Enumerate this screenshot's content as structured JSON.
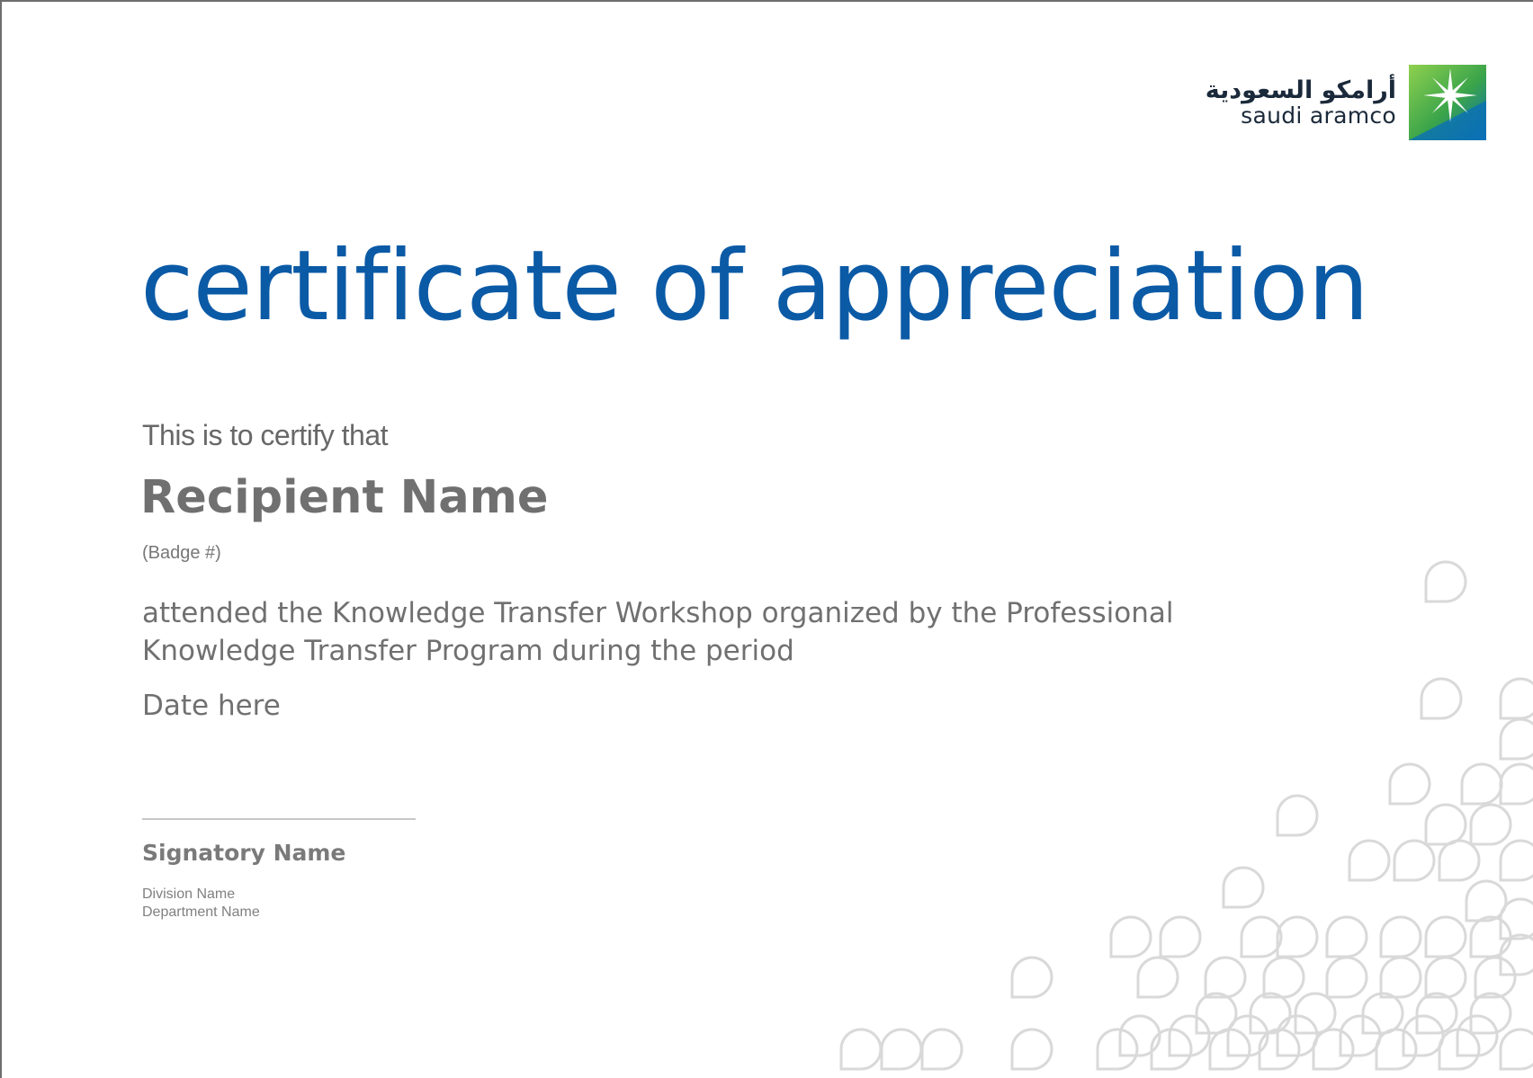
{
  "logo": {
    "arabic": "أرامكو السعودية",
    "latin": "saudi aramco"
  },
  "certificate": {
    "title": "certificate of appreciation",
    "certify_line": "This is to certify that",
    "recipient": "Recipient Name",
    "badge": "(Badge #)",
    "body_line1": "attended the Knowledge Transfer Workshop organized by the Professional",
    "body_line2": "Knowledge Transfer Program during the period",
    "date": "Date here"
  },
  "signatory": {
    "name": "Signatory Name",
    "division": "Division Name",
    "department": "Department Name"
  },
  "colors": {
    "title_blue": "#0b5aa6",
    "text_gray": "#707070",
    "pattern_gray": "#d9d9d9",
    "logo_green": "#6cc04a",
    "logo_blue": "#0a6fb7"
  }
}
